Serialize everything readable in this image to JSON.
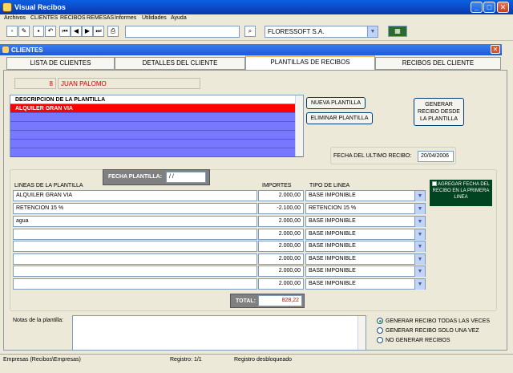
{
  "app": {
    "title": "Visual Recibos"
  },
  "menu": [
    "Archivos",
    "CLIENTES",
    "RECIBOS",
    "REMESAS",
    "Informes",
    "Utilidades",
    "Ayuda"
  ],
  "toolbar": {
    "company": "FLORESSOFT S.A."
  },
  "child_window": {
    "title": "CLIENTES"
  },
  "tabs": [
    {
      "label": "LISTA DE CLIENTES",
      "active": false
    },
    {
      "label": "DETALLES DEL CLIENTE",
      "active": false
    },
    {
      "label": "PLANTILLAS DE RECIBOS",
      "active": true
    },
    {
      "label": "RECIBOS DEL CLIENTE",
      "active": false
    }
  ],
  "client": {
    "id": "8",
    "name": "JUAN PALOMO"
  },
  "templates": {
    "header": "DESCRIPCION DE LA PLANTILLA",
    "rows": [
      "ALQUILER GRAN VIA"
    ]
  },
  "buttons": {
    "new_template": "NUEVA PLANTILLA",
    "delete_template": "ELIMINAR PLANTILLA",
    "generate_receipt": "GENERAR RECIBO DESDE LA PLANTILLA"
  },
  "last_receipt": {
    "label": "FECHA DEL ULTIMO RECIBO:",
    "value": "20/04/2006"
  },
  "template_date": {
    "label": "FECHA PLANTILLA:",
    "value": "/ /"
  },
  "lines_header": {
    "desc": "LINEAS DE LA PLANTILLA",
    "importe": "IMPORTES",
    "tipo": "TIPO DE LINEA"
  },
  "lines": [
    {
      "desc": "ALQUILER GRAN VIA",
      "importe": "2.000,00",
      "tipo": "BASE IMPONIBLE"
    },
    {
      "desc": "RETENCION 15 %",
      "importe": "-2.100,00",
      "tipo": "RETENCION 15 %"
    },
    {
      "desc": "agua",
      "importe": "2.000,00",
      "tipo": "BASE IMPONIBLE"
    },
    {
      "desc": "",
      "importe": "2.000,00",
      "tipo": "BASE IMPONIBLE"
    },
    {
      "desc": "",
      "importe": "2.000,00",
      "tipo": "BASE IMPONIBLE"
    },
    {
      "desc": "",
      "importe": "2.000,00",
      "tipo": "BASE IMPONIBLE"
    },
    {
      "desc": "",
      "importe": "2.000,00",
      "tipo": "BASE IMPONIBLE"
    },
    {
      "desc": "",
      "importe": "2.000,00",
      "tipo": "BASE IMPONIBLE"
    }
  ],
  "add_date_option": {
    "label": "AGREGAR FECHA DEL RECIBO EN LA PRIMERA LINEA",
    "checked": true
  },
  "total": {
    "label": "TOTAL:",
    "value": "828,22"
  },
  "notes": {
    "label": "Notas de la plantilla:",
    "value": ""
  },
  "generate_options": [
    {
      "label": "GENERAR RECIBO TODAS LAS VECES",
      "selected": true
    },
    {
      "label": "GENERAR RECIBO SOLO UNA VEZ",
      "selected": false
    },
    {
      "label": "NO GENERAR RECIBOS",
      "selected": false
    }
  ],
  "status": {
    "db": "Empresas (Recibos\\Empresas)",
    "record": "Registro: 1/1",
    "lock": "Registro desbloqueado"
  },
  "colors": {
    "title_blue": "#0b48c5",
    "selected_row": "#ff0000",
    "template_rows": "#7777ff",
    "green_box": "#004422"
  }
}
